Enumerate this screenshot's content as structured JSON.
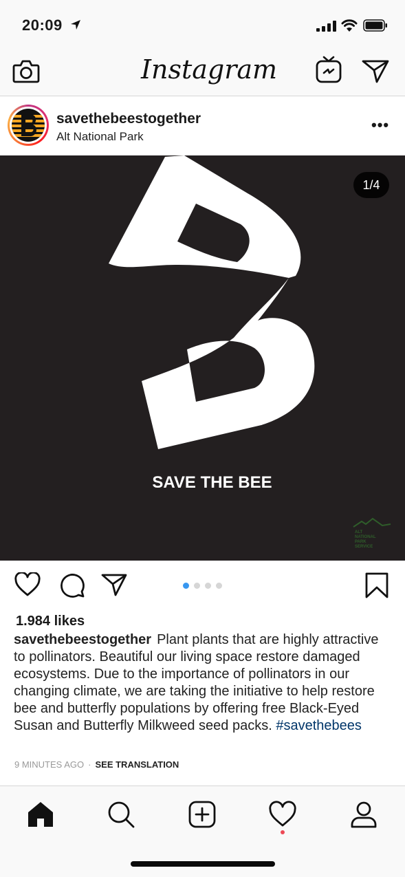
{
  "status_bar": {
    "time": "20:09"
  },
  "header": {
    "app_title": "Instagram"
  },
  "post": {
    "username": "savethebeestogether",
    "location": "Alt National Park",
    "more_label": "•••",
    "slide_counter": "1/4",
    "image_text": "SAVE THE BEE",
    "watermark_lines": [
      "ALT",
      "NATIONAL",
      "PARK",
      "SERVICE"
    ],
    "carousel": {
      "total": 4,
      "active_index": 0
    },
    "likes": "1.984 likes",
    "caption_user": "savethebeestogether",
    "caption_text": "Plant plants that are highly attractive to pollinators. Beautiful our living space restore damaged ecosystems. Due to the importance of pollinators in our changing climate, we are taking the initiative to help restore bee and butterfly populations by offering free Black-Eyed Susan and Butterfly Milkweed seed packs.",
    "caption_hashtag": "#savethebees",
    "time_ago": "9 MINUTES AGO",
    "meta_separator": "·",
    "see_translation": "SEE TRANSLATION"
  },
  "icons": {
    "status": [
      "location-arrow-icon",
      "signal-icon",
      "wifi-icon",
      "battery-icon"
    ],
    "header": [
      "camera-icon",
      "igtv-icon",
      "direct-message-icon"
    ],
    "actions": [
      "heart-icon",
      "comment-icon",
      "share-icon",
      "bookmark-icon"
    ],
    "tabs": [
      "home-icon",
      "search-icon",
      "add-post-icon",
      "activity-heart-icon",
      "profile-icon"
    ]
  },
  "colors": {
    "image_bg": "#231f20",
    "carousel_active": "#3897f0",
    "hashtag": "#003569",
    "notification": "#ed4956",
    "avatar_stripes": "#f5a623"
  }
}
